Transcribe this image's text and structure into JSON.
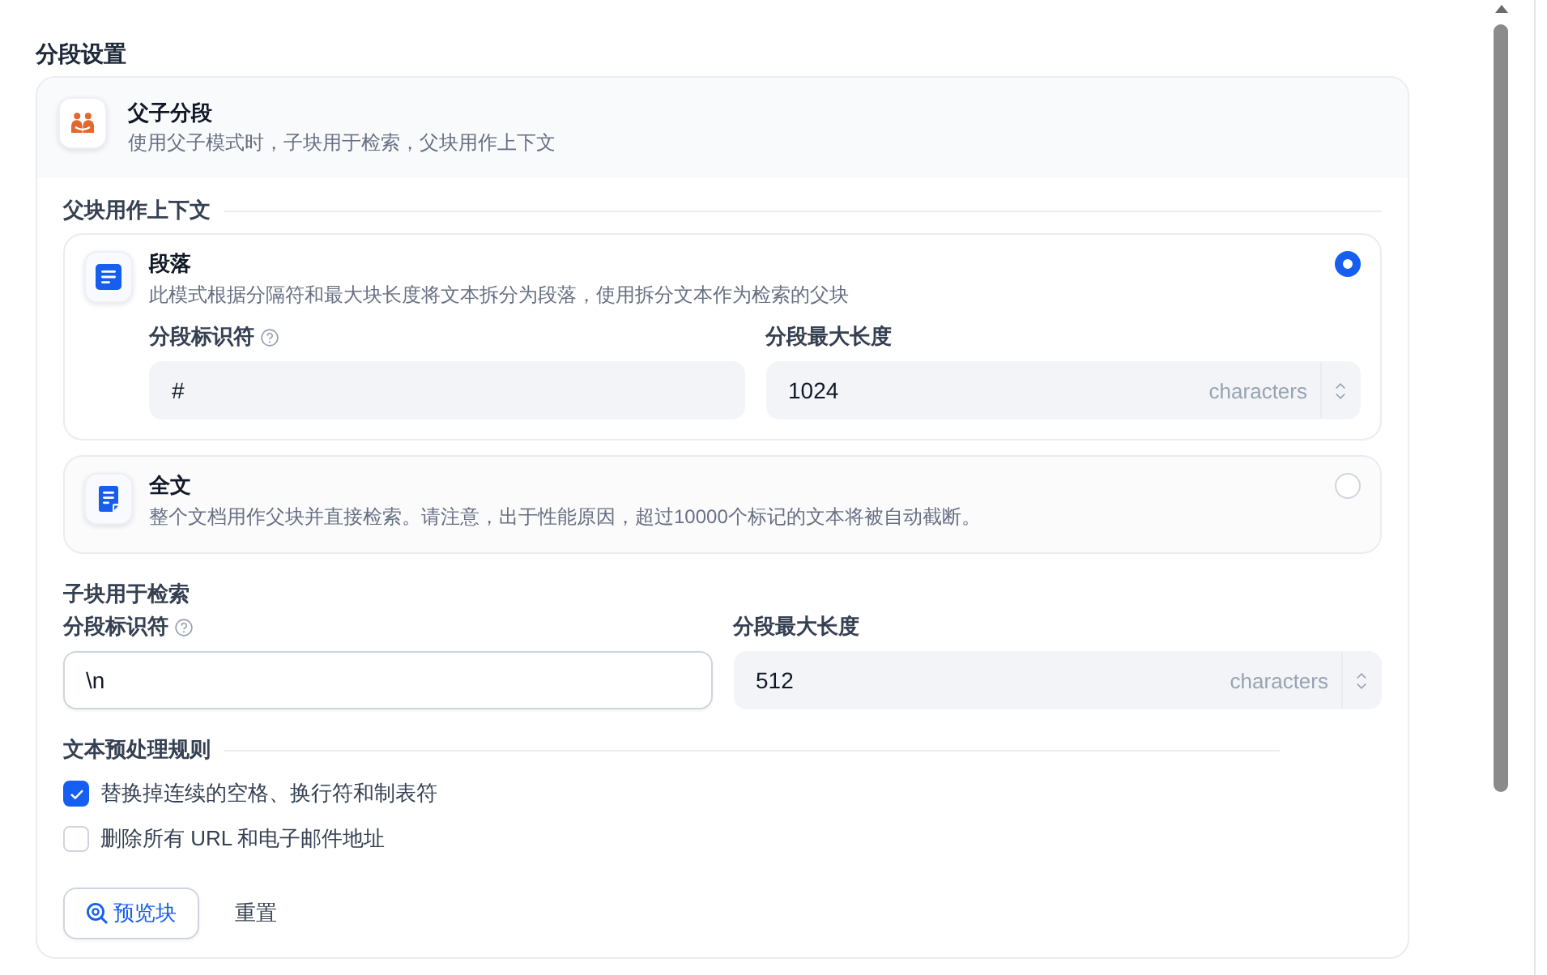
{
  "section_title": "分段设置",
  "mode": {
    "title": "父子分段",
    "description": "使用父子模式时，子块用于检索，父块用作上下文"
  },
  "parent_context": {
    "heading": "父块用作上下文",
    "options": [
      {
        "kind": "paragraph",
        "title": "段落",
        "description": "此模式根据分隔符和最大块长度将文本拆分为段落，使用拆分文本作为检索的父块",
        "selected": true,
        "fields": [
          {
            "kind": "separator",
            "label": "分段标识符",
            "value": "#",
            "focused": false
          },
          {
            "kind": "number",
            "label": "分段最大长度",
            "value": "1024",
            "unit": "characters",
            "focused": false
          }
        ]
      },
      {
        "kind": "full_doc",
        "title": "全文",
        "description": "整个文档用作父块并直接检索。请注意，出于性能原因，超过10000个标记的文本将被自动截断。",
        "selected": false
      }
    ]
  },
  "child_retrieval": {
    "heading": "子块用于检索",
    "fields": [
      {
        "kind": "separator",
        "label": "分段标识符",
        "value": "\\n",
        "focused": true
      },
      {
        "kind": "number",
        "label": "分段最大长度",
        "value": "512",
        "unit": "characters",
        "focused": false
      }
    ]
  },
  "preprocessing": {
    "heading": "文本预处理规则",
    "rules": [
      {
        "label": "替换掉连续的空格、换行符和制表符",
        "checked": true
      },
      {
        "label": "删除所有 URL 和电子邮件地址",
        "checked": false
      }
    ]
  },
  "actions": [
    {
      "kind": "preview",
      "label": "预览块"
    },
    {
      "kind": "reset",
      "label": "重置"
    }
  ]
}
